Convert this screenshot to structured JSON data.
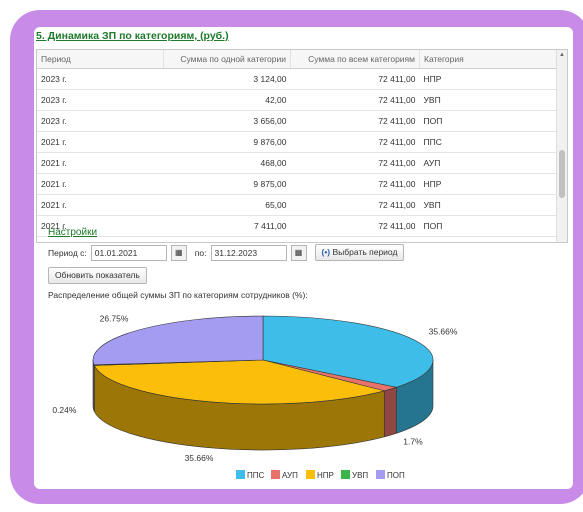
{
  "section_title": "5. Динамика ЗП по категориям, (руб.)",
  "table": {
    "headers": [
      "Период",
      "Сумма по одной категории",
      "Сумма по всем категориям",
      "Категория"
    ],
    "rows": [
      [
        "2023 г.",
        "3 124,00",
        "72 411,00",
        "НПР"
      ],
      [
        "2023 г.",
        "42,00",
        "72 411,00",
        "УВП"
      ],
      [
        "2023 г.",
        "3 656,00",
        "72 411,00",
        "ПОП"
      ],
      [
        "2021 г.",
        "9 876,00",
        "72 411,00",
        "ППС"
      ],
      [
        "2021 г.",
        "468,00",
        "72 411,00",
        "АУП"
      ],
      [
        "2021 г.",
        "9 875,00",
        "72 411,00",
        "НПР"
      ],
      [
        "2021 г.",
        "65,00",
        "72 411,00",
        "УВП"
      ],
      [
        "2021 г.",
        "7 411,00",
        "72 411,00",
        "ПОП"
      ]
    ]
  },
  "settings": {
    "title": "Настройки",
    "period_from_label": "Период с:",
    "period_from_value": "01.01.2021",
    "period_to_label": "по:",
    "period_to_value": "31.12.2023",
    "select_period_label": "Выбрать период",
    "refresh_label": "Обновить показатель"
  },
  "distribution_label": "Распределение общей суммы ЗП по категориям сотрудников (%):",
  "chart_data": {
    "type": "pie",
    "categories": [
      "ППС",
      "АУП",
      "НПР",
      "УВП",
      "ПОП"
    ],
    "values": [
      35.66,
      1.7,
      35.66,
      0.24,
      26.75
    ],
    "slice_labels": [
      "35.66%",
      "1.7%",
      "35.66%",
      "0.24%",
      "26.75%"
    ],
    "colors": [
      "#3dbde8",
      "#e8736a",
      "#fbbe0a",
      "#39b54a",
      "#a49cf0"
    ],
    "legend_position": "bottom"
  }
}
